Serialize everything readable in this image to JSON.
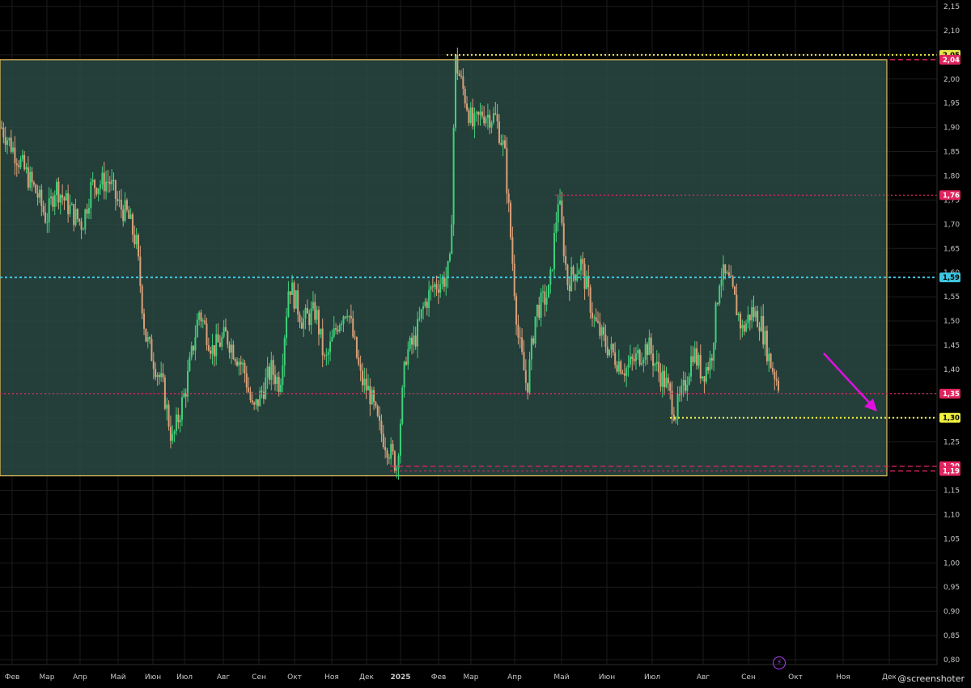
{
  "chart_data": {
    "type": "candlestick",
    "y_ticks": [
      "2,15",
      "2,10",
      "2,05",
      "2,00",
      "1,95",
      "1,90",
      "1,85",
      "1,80",
      "1,75",
      "1,70",
      "1,65",
      "1,60",
      "1,55",
      "1,50",
      "1,45",
      "1,40",
      "1,35",
      "1,30",
      "1,25",
      "1,20",
      "1,15",
      "1,10",
      "1,05",
      "1,00",
      "0,95",
      "0,90",
      "0,85",
      "0,80"
    ],
    "ylim": [
      0.78,
      2.17
    ],
    "x_labels": [
      "Фев",
      "Мар",
      "Апр",
      "Май",
      "Июн",
      "Июл",
      "Авг",
      "Сен",
      "Окт",
      "Ноя",
      "Дек",
      "2025",
      "Фев",
      "Мар",
      "Апр",
      "Май",
      "Июн",
      "Июл",
      "Авг",
      "Сен",
      "Окт",
      "Ноя",
      "Дек"
    ],
    "range_box": {
      "top": 2.04,
      "bottom": 1.18,
      "color": "#2a4a44"
    },
    "levels": [
      {
        "value": 2.05,
        "label": "2,05",
        "color": "#e6e64c",
        "style": "dotted"
      },
      {
        "value": 2.04,
        "label": "2,04",
        "color": "#e0245e",
        "style": "dashed"
      },
      {
        "value": 1.76,
        "label": "1,76",
        "color": "#e0245e",
        "style": "dotted"
      },
      {
        "value": 1.59,
        "label": "1,59",
        "color": "#3ec6e0",
        "style": "dotted"
      },
      {
        "value": 1.35,
        "label": "1,35",
        "color": "#e0245e",
        "style": "dotted"
      },
      {
        "value": 1.3,
        "label": "1,30",
        "color": "#f0f040",
        "style": "dotted"
      },
      {
        "value": 1.2,
        "label": "1,20",
        "color": "#e0245e",
        "style": "dashed"
      },
      {
        "value": 1.19,
        "label": "1,19",
        "color": "#e0245e",
        "style": "dashed"
      }
    ],
    "price_path": [
      [
        0.0,
        1.9
      ],
      [
        0.02,
        1.83
      ],
      [
        0.04,
        1.76
      ],
      [
        0.05,
        1.71
      ],
      [
        0.06,
        1.78
      ],
      [
        0.08,
        1.72
      ],
      [
        0.09,
        1.7
      ],
      [
        0.1,
        1.78
      ],
      [
        0.12,
        1.79
      ],
      [
        0.13,
        1.74
      ],
      [
        0.14,
        1.72
      ],
      [
        0.15,
        1.66
      ],
      [
        0.16,
        1.47
      ],
      [
        0.18,
        1.36
      ],
      [
        0.19,
        1.25
      ],
      [
        0.205,
        1.36
      ],
      [
        0.22,
        1.52
      ],
      [
        0.235,
        1.44
      ],
      [
        0.25,
        1.47
      ],
      [
        0.27,
        1.4
      ],
      [
        0.28,
        1.31
      ],
      [
        0.3,
        1.4
      ],
      [
        0.31,
        1.37
      ],
      [
        0.32,
        1.58
      ],
      [
        0.335,
        1.5
      ],
      [
        0.35,
        1.52
      ],
      [
        0.36,
        1.41
      ],
      [
        0.375,
        1.5
      ],
      [
        0.385,
        1.53
      ],
      [
        0.4,
        1.38
      ],
      [
        0.41,
        1.35
      ],
      [
        0.42,
        1.28
      ],
      [
        0.435,
        1.22
      ],
      [
        0.44,
        1.2
      ],
      [
        0.45,
        1.43
      ],
      [
        0.46,
        1.46
      ],
      [
        0.47,
        1.53
      ],
      [
        0.48,
        1.57
      ],
      [
        0.495,
        1.59
      ],
      [
        0.5,
        1.62
      ],
      [
        0.505,
        2.04
      ],
      [
        0.515,
        1.97
      ],
      [
        0.525,
        1.9
      ],
      [
        0.535,
        1.93
      ],
      [
        0.55,
        1.92
      ],
      [
        0.56,
        1.85
      ],
      [
        0.565,
        1.72
      ],
      [
        0.575,
        1.47
      ],
      [
        0.585,
        1.36
      ],
      [
        0.595,
        1.52
      ],
      [
        0.61,
        1.56
      ],
      [
        0.62,
        1.76
      ],
      [
        0.63,
        1.58
      ],
      [
        0.645,
        1.62
      ],
      [
        0.66,
        1.5
      ],
      [
        0.67,
        1.46
      ],
      [
        0.685,
        1.42
      ],
      [
        0.695,
        1.4
      ],
      [
        0.71,
        1.43
      ],
      [
        0.72,
        1.45
      ],
      [
        0.73,
        1.4
      ],
      [
        0.74,
        1.37
      ],
      [
        0.75,
        1.31
      ],
      [
        0.76,
        1.36
      ],
      [
        0.77,
        1.44
      ],
      [
        0.78,
        1.39
      ],
      [
        0.79,
        1.42
      ],
      [
        0.8,
        1.6
      ],
      [
        0.81,
        1.58
      ],
      [
        0.815,
        1.55
      ],
      [
        0.825,
        1.48
      ],
      [
        0.835,
        1.52
      ],
      [
        0.845,
        1.5
      ],
      [
        0.855,
        1.42
      ],
      [
        0.865,
        1.37
      ]
    ],
    "annotation_arrow": {
      "color": "#e010e0"
    }
  },
  "watermark": "@screenshoter",
  "bolt_icon": "⚡"
}
